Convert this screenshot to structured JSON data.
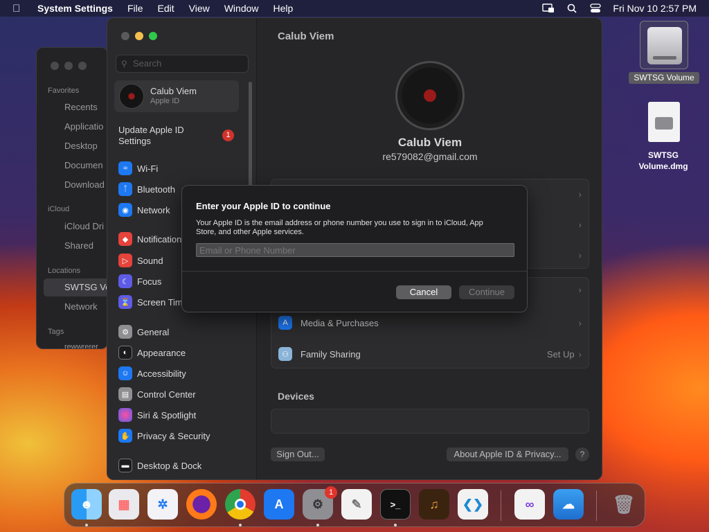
{
  "menubar": {
    "app_name": "System Settings",
    "items": [
      "File",
      "Edit",
      "View",
      "Window",
      "Help"
    ],
    "datetime": "Fri Nov 10  2:57 PM"
  },
  "finder": {
    "favorites_label": "Favorites",
    "favorites": [
      "Recents",
      "Applicatio",
      "Desktop",
      "Documen",
      "Download"
    ],
    "icloud_label": "iCloud",
    "icloud": [
      "iCloud Dri",
      "Shared"
    ],
    "locations_label": "Locations",
    "locations": [
      "SWTSG Vo",
      "Network"
    ],
    "tags_label": "Tags",
    "tags": [
      "rewwrerer"
    ]
  },
  "sidebar": {
    "search_placeholder": "Search",
    "profile_name": "Calub Viem",
    "profile_sub": "Apple ID",
    "update_label": "Update Apple ID Settings",
    "update_badge": "1",
    "items": [
      {
        "label": "Wi-Fi",
        "color": "#1d78f2"
      },
      {
        "label": "Bluetooth",
        "color": "#1d78f2"
      },
      {
        "label": "Network",
        "color": "#1d78f2"
      },
      {
        "label": "Notifications",
        "color": "#e5433b"
      },
      {
        "label": "Sound",
        "color": "#e5433b"
      },
      {
        "label": "Focus",
        "color": "#5e5ce6"
      },
      {
        "label": "Screen Time",
        "color": "#5e5ce6"
      },
      {
        "label": "General",
        "color": "#8e8e93"
      },
      {
        "label": "Appearance",
        "color": "#1c1c1e"
      },
      {
        "label": "Accessibility",
        "color": "#1d78f2"
      },
      {
        "label": "Control Center",
        "color": "#8e8e93"
      },
      {
        "label": "Siri & Spotlight",
        "color": "#bf5af2"
      },
      {
        "label": "Privacy & Security",
        "color": "#1d78f2"
      },
      {
        "label": "Desktop & Dock",
        "color": "#1c1c1e"
      }
    ]
  },
  "content": {
    "title": "Calub Viem",
    "name": "Calub Viem",
    "email": "re579082@gmail.com",
    "rows": [
      {
        "label": "Media & Purchases",
        "value": ""
      },
      {
        "label": "Family Sharing",
        "value": "Set Up"
      }
    ],
    "devices_label": "Devices",
    "sign_out": "Sign Out...",
    "about": "About Apple ID & Privacy...",
    "help": "?"
  },
  "dialog": {
    "title": "Enter your Apple ID to continue",
    "body": "Your Apple ID is the email address or phone number you use to sign in to iCloud, App Store, and other Apple services.",
    "input_placeholder": "Email or Phone Number",
    "cancel": "Cancel",
    "continue": "Continue"
  },
  "desktop": {
    "volume_label": "SWTSG Volume",
    "dmg_label": "SWTSG Volume.dmg"
  },
  "dock": {
    "apps": [
      {
        "name": "Finder",
        "color": "#1e8ff0"
      },
      {
        "name": "Launchpad",
        "color": "#e9e9ee"
      },
      {
        "name": "Safari",
        "color": "#f2f2f7"
      },
      {
        "name": "Firefox",
        "color": "#6b21a8"
      },
      {
        "name": "Chrome",
        "color": "#f2f2f2"
      },
      {
        "name": "App Store",
        "color": "#1d78f2"
      },
      {
        "name": "System Settings",
        "color": "#8e8e93"
      },
      {
        "name": "TextEdit",
        "color": "#f2f2f2"
      },
      {
        "name": "Terminal",
        "color": "#111111"
      },
      {
        "name": "GarageBand",
        "color": "#3a2410"
      },
      {
        "name": "VS Code",
        "color": "#f2f2f2"
      },
      {
        "name": "Visual Studio",
        "color": "#f2f2f2"
      },
      {
        "name": "Weather",
        "color": "#2f8ee8"
      },
      {
        "name": "Trash",
        "color": "#9a9aa0"
      }
    ],
    "settings_badge": "1"
  }
}
